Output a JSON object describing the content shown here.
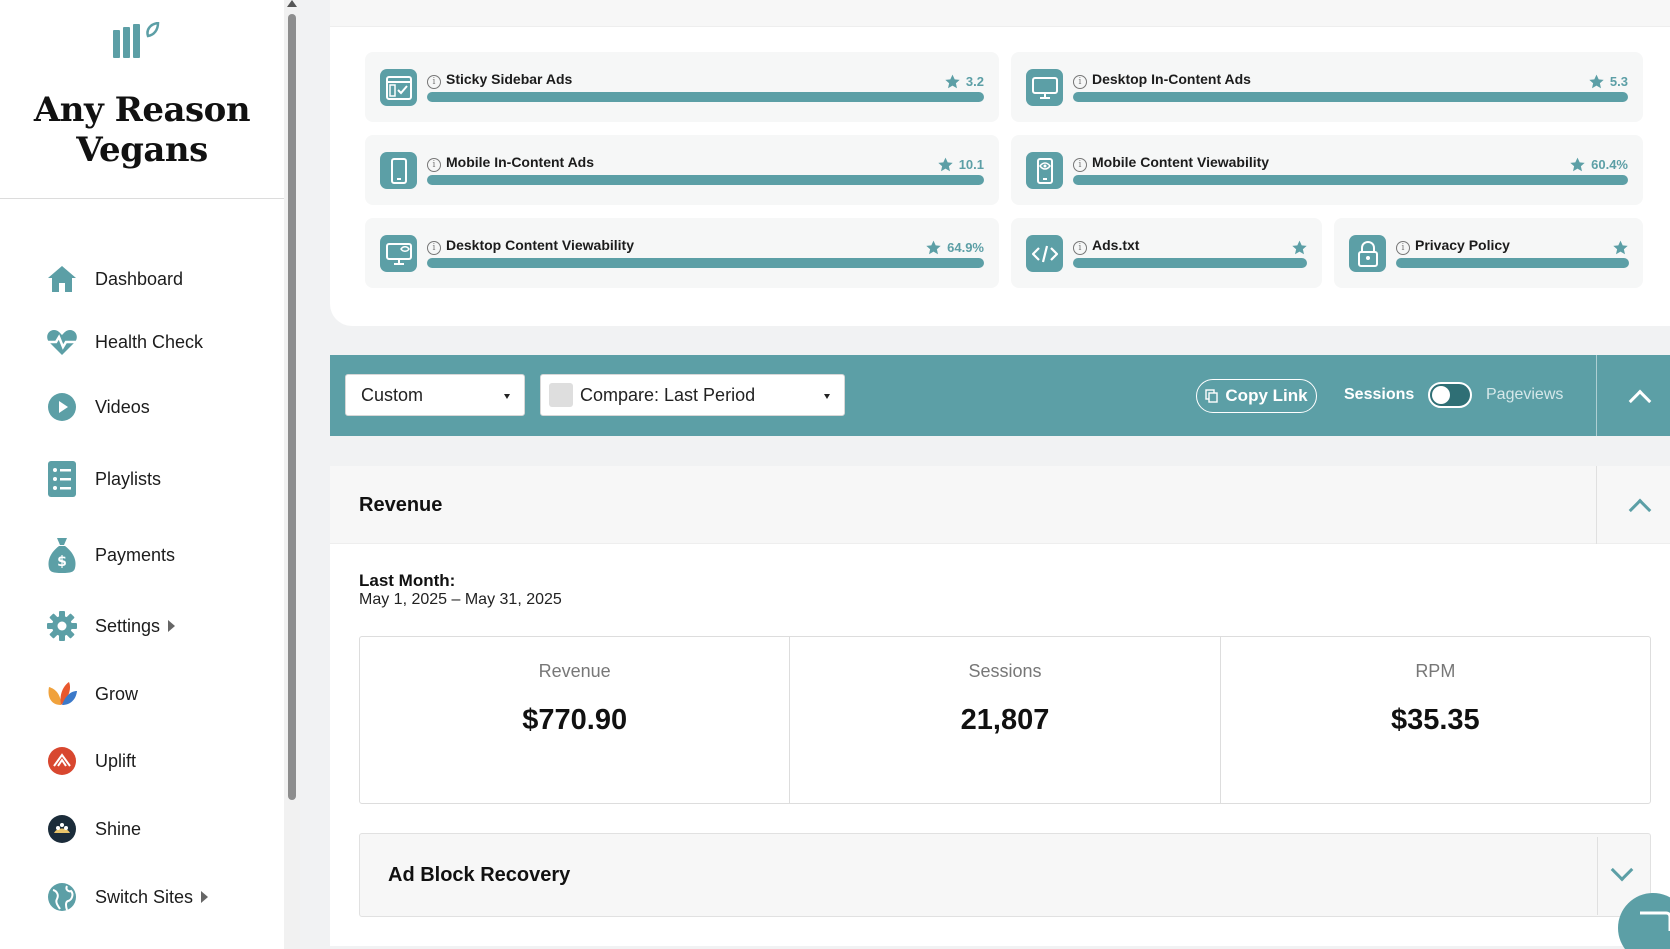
{
  "sidebar": {
    "site_title_line1": "Any Reason",
    "site_title_line2": "Vegans",
    "items": [
      {
        "label": "Dashboard",
        "icon": "home-icon"
      },
      {
        "label": "Health Check",
        "icon": "heartbeat-icon"
      },
      {
        "label": "Videos",
        "icon": "play-icon"
      },
      {
        "label": "Playlists",
        "icon": "playlist-icon"
      },
      {
        "label": "Payments",
        "icon": "money-bag-icon"
      },
      {
        "label": "Settings",
        "icon": "gear-icon"
      },
      {
        "label": "Grow",
        "icon": "grow-icon"
      },
      {
        "label": "Uplift",
        "icon": "uplift-icon"
      },
      {
        "label": "Shine",
        "icon": "shine-icon"
      },
      {
        "label": "Switch Sites",
        "icon": "globe-icon"
      }
    ]
  },
  "metrics": [
    {
      "label": "Sticky Sidebar Ads",
      "value": "3.2",
      "icon": "browser-check-icon"
    },
    {
      "label": "Desktop In-Content Ads",
      "value": "5.3",
      "icon": "desktop-icon"
    },
    {
      "label": "Mobile In-Content Ads",
      "value": "10.1",
      "icon": "mobile-icon"
    },
    {
      "label": "Mobile Content Viewability",
      "value": "60.4%",
      "icon": "mobile-eye-icon"
    },
    {
      "label": "Desktop Content Viewability",
      "value": "64.9%",
      "icon": "desktop-eye-icon"
    },
    {
      "label": "Ads.txt",
      "value": "",
      "icon": "code-icon"
    },
    {
      "label": "Privacy Policy",
      "value": "",
      "icon": "lock-icon"
    }
  ],
  "filter": {
    "date_select": "Custom",
    "compare_select": "Compare: Last Period",
    "copy_link": "Copy Link",
    "toggle_left": "Sessions",
    "toggle_right": "Pageviews"
  },
  "revenue": {
    "title": "Revenue",
    "period_label": "Last Month:",
    "period_range": "May 1, 2025 – May 31, 2025",
    "stats": [
      {
        "label": "Revenue",
        "value": "$770.90"
      },
      {
        "label": "Sessions",
        "value": "21,807"
      },
      {
        "label": "RPM",
        "value": "$35.35"
      }
    ]
  },
  "adblock": {
    "title": "Ad Block Recovery"
  },
  "colors": {
    "accent": "#5c9fa6"
  }
}
